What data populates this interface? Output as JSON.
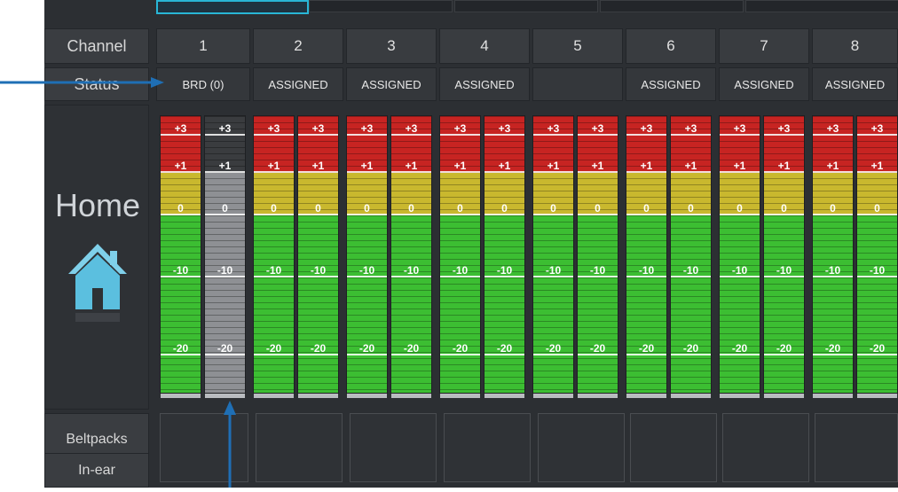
{
  "labels": {
    "channel": "Channel",
    "status": "Status",
    "home": "Home",
    "beltpacks": "Beltpacks",
    "in_ear": "In-ear"
  },
  "channels": [
    {
      "number": "1",
      "status": "BRD (0)"
    },
    {
      "number": "2",
      "status": "ASSIGNED"
    },
    {
      "number": "3",
      "status": "ASSIGNED"
    },
    {
      "number": "4",
      "status": "ASSIGNED"
    },
    {
      "number": "5",
      "status": ""
    },
    {
      "number": "6",
      "status": "ASSIGNED"
    },
    {
      "number": "7",
      "status": "ASSIGNED"
    },
    {
      "number": "8",
      "status": "ASSIGNED"
    }
  ],
  "meter_scale": [
    "+3",
    "+1",
    "0",
    "-10",
    "-20"
  ],
  "colors": {
    "red": "#c72422",
    "yellow": "#c9b82e",
    "green": "#3cbe32",
    "inactive": "#8e9094",
    "accent": "#29b6d6",
    "annotation_arrow": "#1f6fb5"
  },
  "icons": {
    "home": "home-icon",
    "annotation_left": "arrow-right-icon",
    "annotation_bottom": "arrow-up-icon"
  }
}
